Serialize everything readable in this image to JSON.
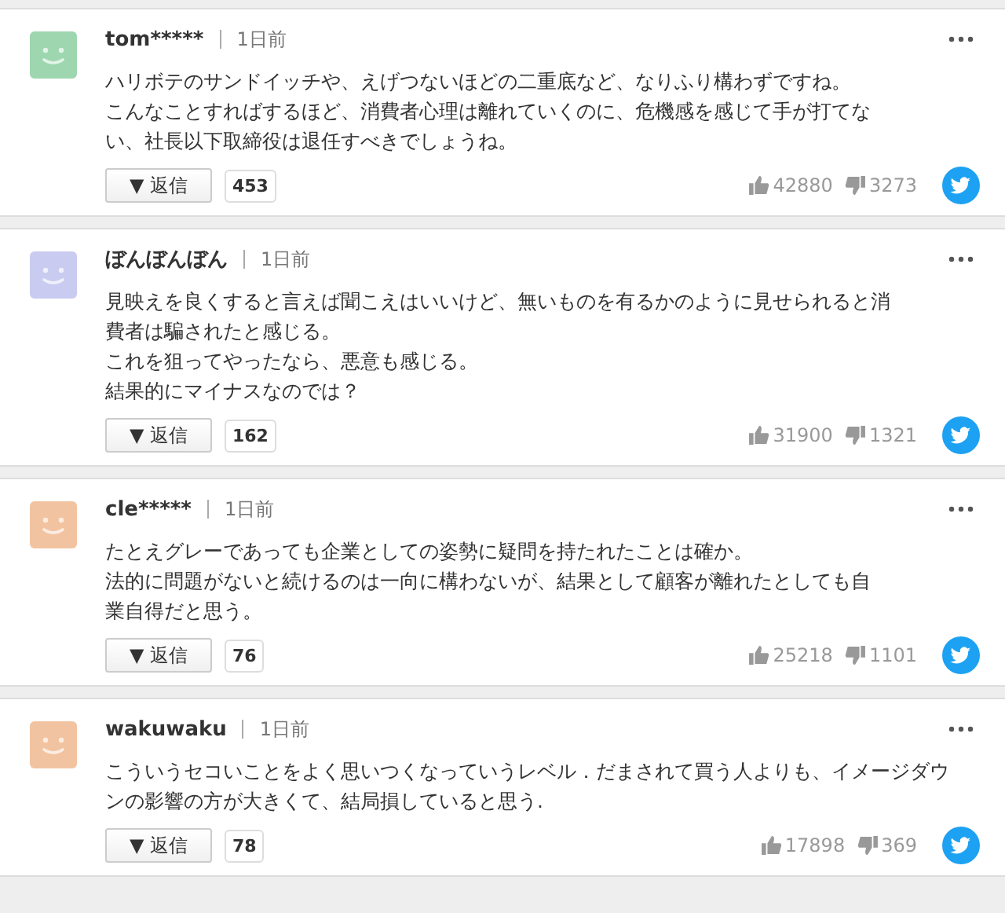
{
  "comments": [
    {
      "color": "#9ed6b0",
      "user": "tom*****",
      "time": "1日前",
      "lines": [
        "ハリボテのサンドイッチや、えげつないほどの二重底など、なりふり構わずですね。",
        "こんなことすればするほど、消費者心理は離れていくのに、危機感を感じて手が打てな",
        "い、社長以下取締役は退任すべきでしょうね。"
      ],
      "reply": "▼ 返信",
      "reply_count": "453",
      "likes": "42880",
      "dislikes": "3273"
    },
    {
      "color": "#c9cbf0",
      "user": "ぼんぼんぼん",
      "time": "1日前",
      "lines": [
        "見映えを良くすると言えば聞こえはいいけど、無いものを有るかのように見せられると消",
        "費者は騙されたと感じる。",
        "これを狙ってやったなら、悪意も感じる。",
        "結果的にマイナスなのでは？"
      ],
      "reply": "▼ 返信",
      "reply_count": "162",
      "likes": "31900",
      "dislikes": "1321"
    },
    {
      "color": "#f2c3a0",
      "user": "cle*****",
      "time": "1日前",
      "lines": [
        "たとえグレーであっても企業としての姿勢に疑問を持たれたことは確か。",
        "法的に問題がないと続けるのは一向に構わないが、結果として顧客が離れたとしても自",
        "業自得だと思う。"
      ],
      "reply": "▼ 返信",
      "reply_count": "76",
      "likes": "25218",
      "dislikes": "1101"
    },
    {
      "color": "#f2c3a0",
      "user": "wakuwaku",
      "time": "1日前",
      "lines": [
        "こういうセコいことをよく思いつくなっていうレベル．だまされて買う人よりも、イメージダウ",
        "ンの影響の方が大きくて、結局損していると思う."
      ],
      "reply": "▼ 返信",
      "reply_count": "78",
      "likes": "17898",
      "dislikes": "369"
    }
  ]
}
